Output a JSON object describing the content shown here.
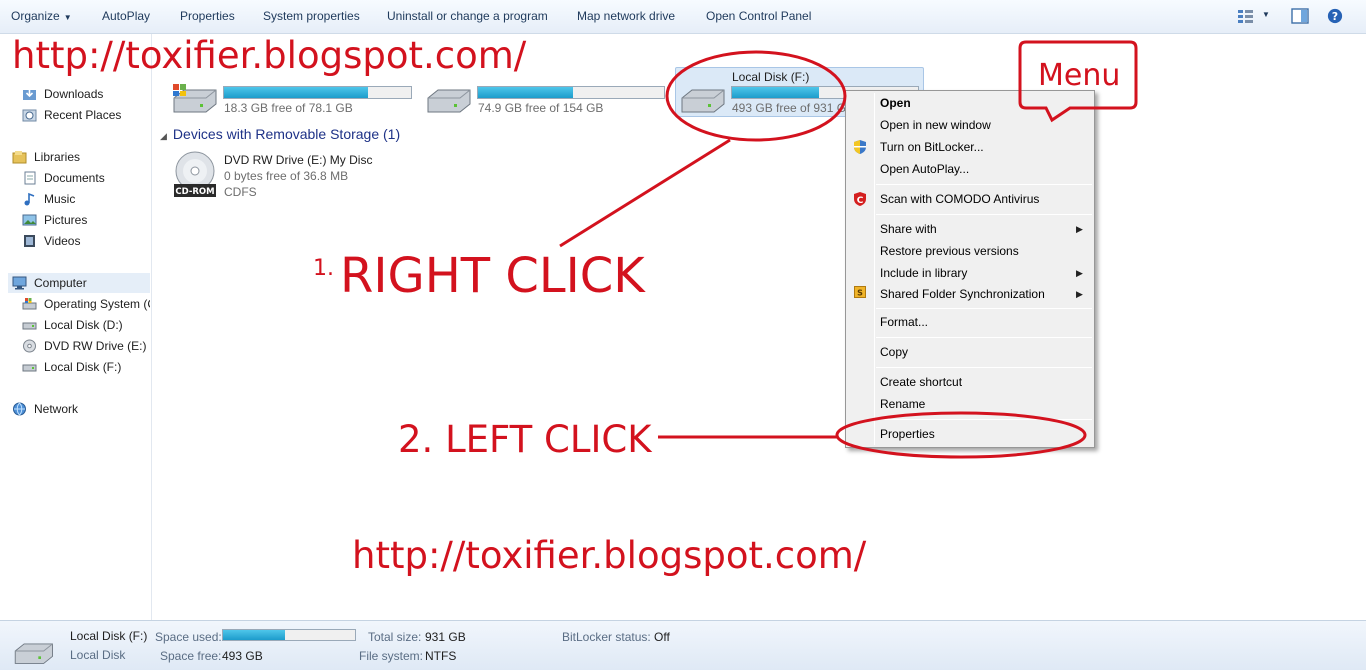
{
  "toolbar": {
    "organize": "Organize",
    "autoplay": "AutoPlay",
    "properties": "Properties",
    "system_properties": "System properties",
    "uninstall": "Uninstall or change a program",
    "map_network": "Map network drive",
    "open_control_panel": "Open Control Panel",
    "icons": [
      "view-options-icon",
      "preview-pane-icon",
      "help-icon"
    ]
  },
  "nav": {
    "favorites": [
      {
        "label": "Downloads",
        "icon": "downloads-icon"
      },
      {
        "label": "Recent Places",
        "icon": "recent-places-icon"
      }
    ],
    "libraries": {
      "label": "Libraries",
      "items": [
        {
          "label": "Documents",
          "icon": "documents-icon"
        },
        {
          "label": "Music",
          "icon": "music-icon"
        },
        {
          "label": "Pictures",
          "icon": "pictures-icon"
        },
        {
          "label": "Videos",
          "icon": "videos-icon"
        }
      ]
    },
    "computer": {
      "label": "Computer",
      "items": [
        {
          "label": "Operating System (C",
          "icon": "os-drive-icon"
        },
        {
          "label": "Local Disk (D:)",
          "icon": "hard-drive-icon"
        },
        {
          "label": "DVD RW Drive (E:) M",
          "icon": "dvd-drive-icon"
        },
        {
          "label": "Local Disk (F:)",
          "icon": "hard-drive-icon"
        }
      ]
    },
    "network": "Network"
  },
  "drives": [
    {
      "free": "18.3 GB free of 78.1 GB",
      "used_fraction": 0.77,
      "icon": "windows-drive-icon"
    },
    {
      "free": "74.9 GB free of 154 GB",
      "used_fraction": 0.51,
      "icon": "hard-drive-icon"
    },
    {
      "name": "Local Disk (F:)",
      "free": "493 GB free of 931 GB",
      "used_fraction": 0.47,
      "icon": "hard-drive-icon"
    }
  ],
  "removable": {
    "section_title": "Devices with Removable Storage (1)",
    "name": "DVD RW Drive (E:) My Disc",
    "free": "0 bytes free of 36.8 MB",
    "fs": "CDFS",
    "icon_text": "CD-ROM"
  },
  "context_menu": {
    "items": [
      {
        "label": "Open",
        "bold": true
      },
      {
        "label": "Open in new window"
      },
      {
        "label": "Turn on BitLocker...",
        "icon": "shield-icon"
      },
      {
        "label": "Open AutoPlay..."
      },
      {
        "label": "Scan with COMODO Antivirus",
        "icon": "comodo-icon"
      },
      {
        "label": "Share with",
        "submenu": true
      },
      {
        "label": "Restore previous versions"
      },
      {
        "label": "Include in library",
        "submenu": true
      },
      {
        "label": "Shared Folder Synchronization",
        "submenu": true,
        "icon": "sync-icon"
      },
      {
        "label": "Format..."
      },
      {
        "label": "Copy"
      },
      {
        "label": "Create shortcut"
      },
      {
        "label": "Rename"
      },
      {
        "label": "Properties"
      }
    ]
  },
  "annotations": {
    "url_top": "http://toxifier.blogspot.com/",
    "url_bottom": "http://toxifier.blogspot.com/",
    "menu_callout": "Menu",
    "step1_num": "1.",
    "step1_text": "RIGHT CLICK",
    "step2_text": "2. LEFT CLICK",
    "color": "#d3121e"
  },
  "details": {
    "name": "Local Disk (F:)",
    "type": "Local Disk",
    "space_used_label": "Space used:",
    "space_used_fraction": 0.47,
    "space_free_label": "Space free:",
    "space_free": "493 GB",
    "total_size_label": "Total size:",
    "total_size": "931 GB",
    "file_system_label": "File system:",
    "file_system": "NTFS",
    "bitlocker_label": "BitLocker status:",
    "bitlocker": "Off"
  },
  "colors": {
    "accent_blue": "#1d9ccb",
    "selection": "#dbe9f7",
    "annotation_red": "#d3121e"
  }
}
